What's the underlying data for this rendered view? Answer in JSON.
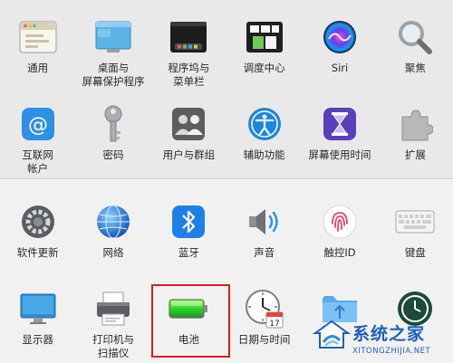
{
  "rows": [
    [
      {
        "label": "通用",
        "icon": "general-icon"
      },
      {
        "label": "桌面与\n屏幕保护程序",
        "icon": "desktop-screensaver-icon"
      },
      {
        "label": "程序坞与\n菜单栏",
        "icon": "dock-menubar-icon"
      },
      {
        "label": "调度中心",
        "icon": "mission-control-icon"
      },
      {
        "label": "Siri",
        "icon": "siri-icon"
      },
      {
        "label": "聚焦",
        "icon": "spotlight-icon"
      }
    ],
    [
      {
        "label": "互联网\n帐户",
        "icon": "internet-accounts-icon"
      },
      {
        "label": "密码",
        "icon": "passwords-icon"
      },
      {
        "label": "用户与群组",
        "icon": "users-groups-icon"
      },
      {
        "label": "辅助功能",
        "icon": "accessibility-icon"
      },
      {
        "label": "屏幕使用时间",
        "icon": "screen-time-icon"
      },
      {
        "label": "扩展",
        "icon": "extensions-icon"
      }
    ],
    [
      {
        "label": "软件更新",
        "icon": "software-update-icon"
      },
      {
        "label": "网络",
        "icon": "network-icon"
      },
      {
        "label": "蓝牙",
        "icon": "bluetooth-icon"
      },
      {
        "label": "声音",
        "icon": "sound-icon"
      },
      {
        "label": "触控ID",
        "icon": "touch-id-icon"
      },
      {
        "label": "键盘",
        "icon": "keyboard-icon"
      }
    ],
    [
      {
        "label": "显示器",
        "icon": "displays-icon"
      },
      {
        "label": "打印机与\n扫描仪",
        "icon": "printers-scanners-icon"
      },
      {
        "label": "电池",
        "icon": "battery-icon"
      },
      {
        "label": "日期与时间",
        "icon": "date-time-icon"
      },
      {
        "label": "",
        "icon": "sharing-folder-icon"
      },
      {
        "label": "",
        "icon": "time-machine-icon"
      }
    ]
  ],
  "date_icon_day": "17",
  "watermark": {
    "title": "系统之家",
    "url": "XITONGZHIJIA.NET"
  }
}
